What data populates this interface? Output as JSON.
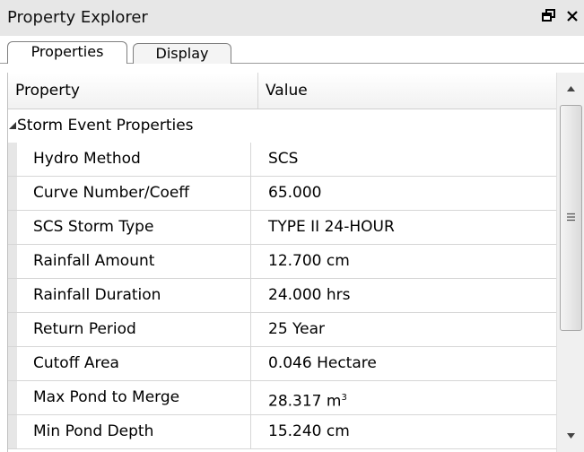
{
  "window": {
    "title": "Property Explorer",
    "controls": [
      "pin-icon",
      "close-icon"
    ]
  },
  "tabs": [
    {
      "label": "Properties",
      "active": true
    },
    {
      "label": "Display",
      "active": false
    }
  ],
  "grid": {
    "headers": {
      "property": "Property",
      "value": "Value"
    },
    "category": {
      "label": "Storm Event Properties",
      "expanded": true
    },
    "rows": [
      {
        "name": "Hydro Method",
        "value": "SCS"
      },
      {
        "name": "Curve Number/Coeff",
        "value": "65.000"
      },
      {
        "name": "SCS Storm Type",
        "value": "TYPE II 24-HOUR"
      },
      {
        "name": "Rainfall Amount",
        "value": "12.700 cm"
      },
      {
        "name": "Rainfall Duration",
        "value": "24.000 hrs"
      },
      {
        "name": "Return Period",
        "value": "25 Year"
      },
      {
        "name": "Cutoff Area",
        "value": "0.046 Hectare"
      },
      {
        "name": "Max Pond to Merge",
        "value": "28.317 m",
        "value_sup": "3"
      },
      {
        "name": "Min Pond Depth",
        "value": "15.240 cm"
      }
    ]
  },
  "colors": {
    "titlebar": "#e7e7e7",
    "gutter": "#e6e6e6",
    "scrollbar": "#f0f0f0"
  }
}
